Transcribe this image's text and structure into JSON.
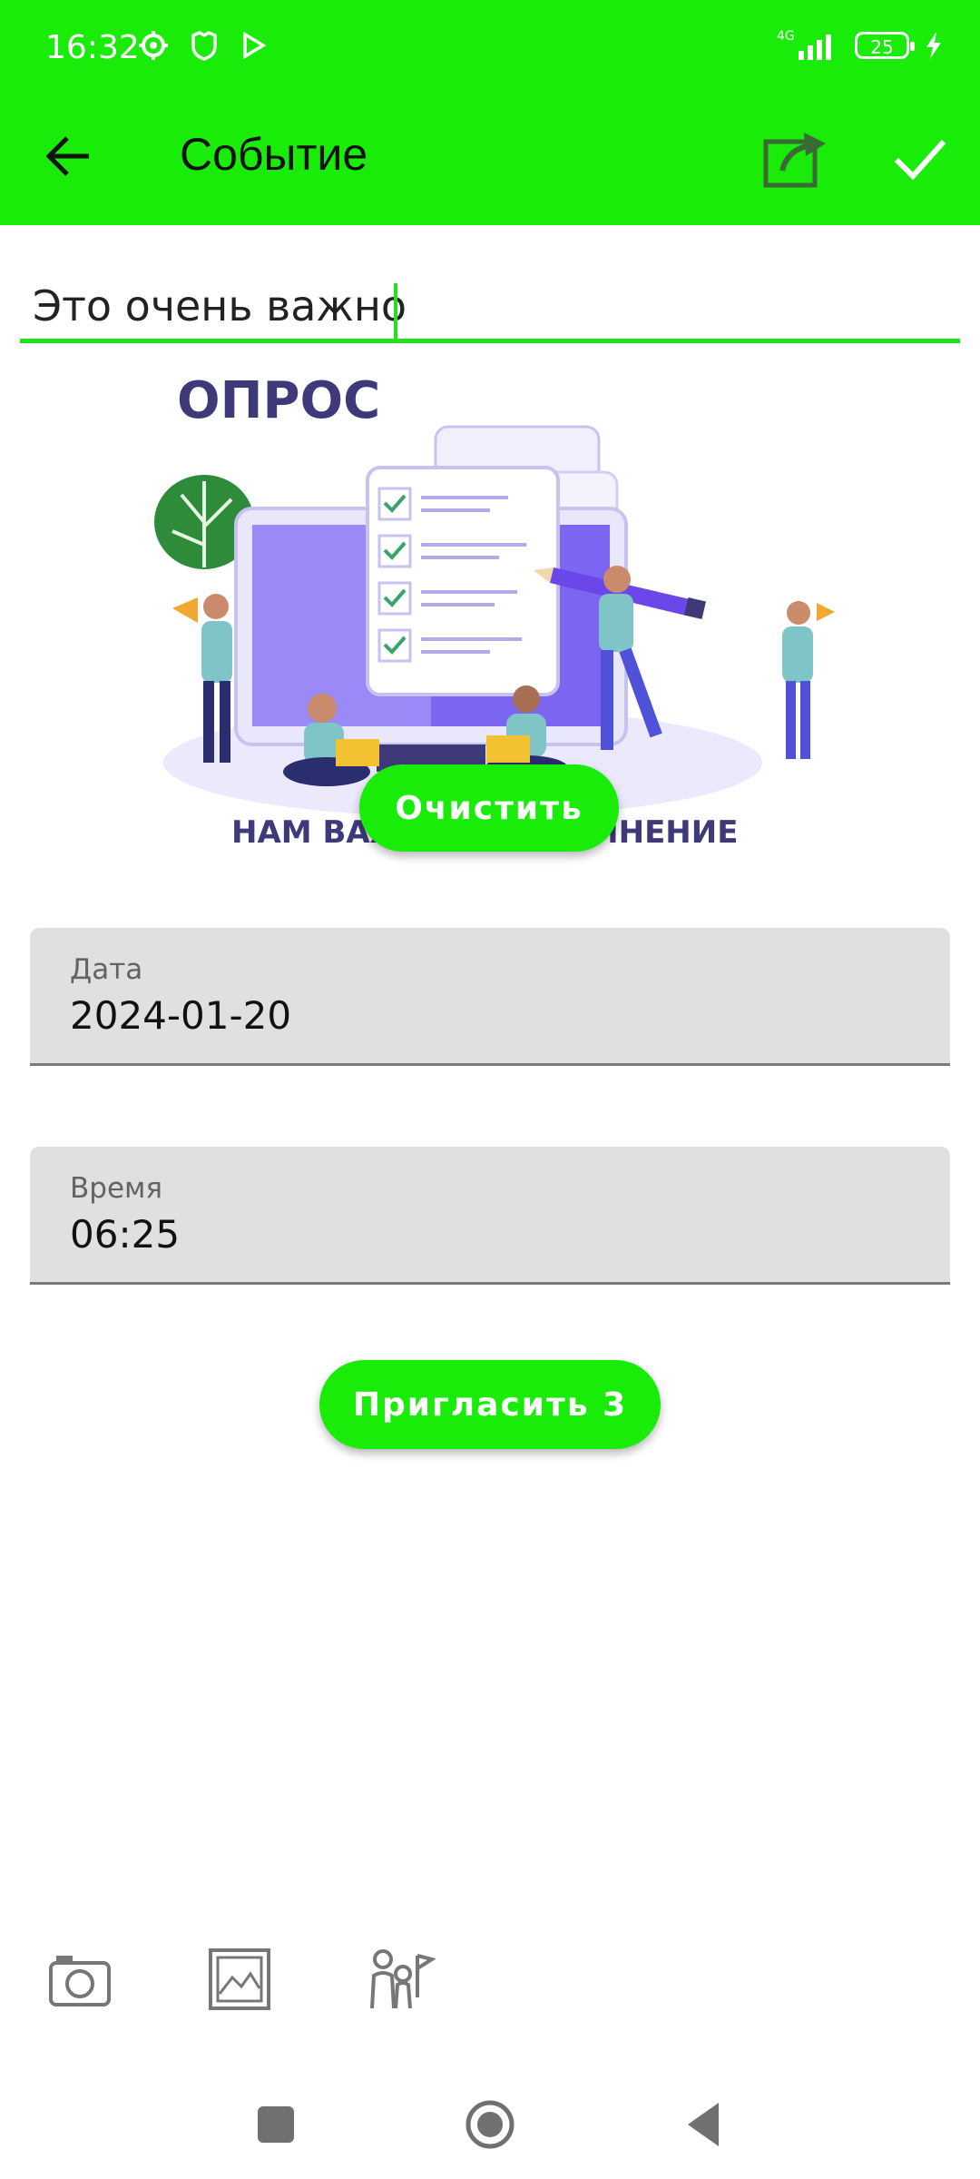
{
  "status_bar": {
    "time": "16:32",
    "network": "4G",
    "battery": "25",
    "icons": [
      "settings-gear-icon",
      "mi-shield-icon",
      "play-icon",
      "signal-icon",
      "battery-icon",
      "charging-icon"
    ]
  },
  "app_bar": {
    "title": "Событие",
    "icons": [
      "back-arrow-icon",
      "share-icon",
      "check-icon"
    ]
  },
  "event_text": {
    "value": "Это очень важно"
  },
  "illustration": {
    "headline": "ОПРОС",
    "footer": "НАМ ВАЖНО ВАШЕ МНЕНИЕ"
  },
  "clear_button": {
    "label": "Очистить"
  },
  "date_field": {
    "label": "Дата",
    "value": "2024-01-20"
  },
  "time_field": {
    "label": "Время",
    "value": "06:25"
  },
  "invite_button": {
    "label": "Пригласить 3"
  },
  "toolbar": {
    "icons": [
      "camera-icon",
      "gallery-icon",
      "people-icon"
    ]
  },
  "nav_bar": {
    "icons": [
      "recent-apps-icon",
      "home-icon",
      "back-icon"
    ]
  },
  "colors": {
    "accent": "#1aec0a",
    "field_bg": "#e0e0e0",
    "illustration_purple": "#3e3a7a"
  }
}
